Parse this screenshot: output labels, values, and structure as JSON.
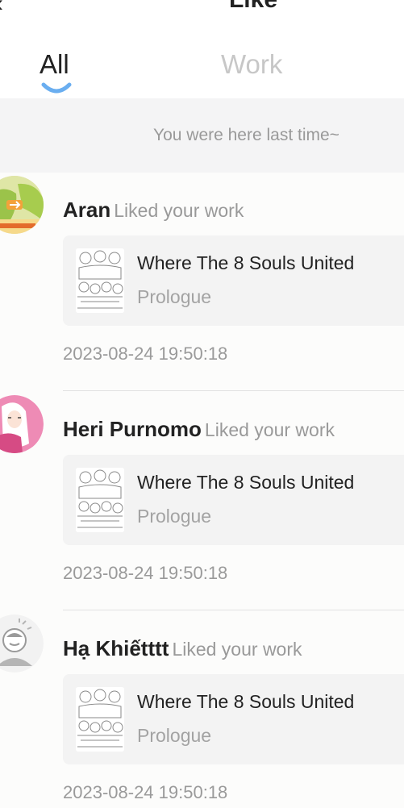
{
  "header": {
    "back_icon": "chevron-left-icon",
    "title": "Like"
  },
  "tabs": [
    {
      "label": "All",
      "active": true
    },
    {
      "label": "Work",
      "active": false
    }
  ],
  "accent_color": "#6aaef0",
  "banner": {
    "text": "You were here last time~"
  },
  "notifications": [
    {
      "user": "Aran",
      "action": "Liked your work",
      "work_title": "Where The 8 Souls United",
      "chapter": "Prologue",
      "time": "2023-08-24 19:50:18",
      "avatar": "anime-avatar-green"
    },
    {
      "user": "Heri Purnomo",
      "action": "Liked your work",
      "work_title": "Where The 8 Souls United",
      "chapter": "Prologue",
      "time": "2023-08-24 19:50:18",
      "avatar": "anime-avatar-pink"
    },
    {
      "user": "Hạ Khiếtttt",
      "action": "Liked your work",
      "work_title": "Where The 8 Souls United",
      "chapter": "Prologue",
      "time": "2023-08-24 19:50:18",
      "avatar": "default-avatar"
    }
  ]
}
